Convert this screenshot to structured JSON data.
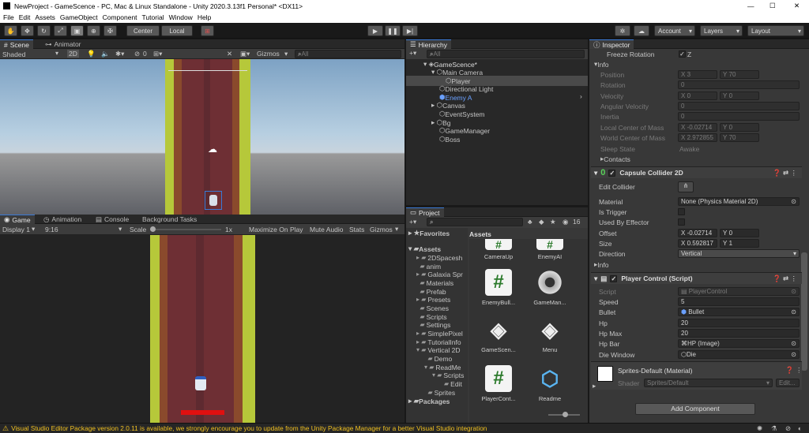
{
  "window": {
    "title": "NewProject - GameScence - PC, Mac & Linux Standalone - Unity 2020.3.13f1 Personal* <DX11>",
    "min": "—",
    "max": "☐",
    "close": "✕"
  },
  "menu": [
    "File",
    "Edit",
    "Assets",
    "GameObject",
    "Component",
    "Tutorial",
    "Window",
    "Help"
  ],
  "toolbar": {
    "center": "Center",
    "local": "Local",
    "account": "Account",
    "layers": "Layers",
    "layout": "Layout"
  },
  "scene": {
    "tabs": [
      "Scene",
      "Animator"
    ],
    "shading": "Shaded",
    "mode2d": "2D",
    "fx_count": "0",
    "gizmos": "Gizmos",
    "search_placeholder": "All"
  },
  "game": {
    "tabs": [
      "Game",
      "Animation",
      "Console",
      "Background Tasks"
    ],
    "display": "Display 1",
    "aspect": "9:16",
    "scale_label": "Scale",
    "scale_value": "1x",
    "maximize": "Maximize On Play",
    "mute": "Mute Audio",
    "stats": "Stats",
    "gizmos": "Gizmos"
  },
  "hierarchy": {
    "tab": "Hierarchy",
    "search_placeholder": "All",
    "scene": "GameScence*",
    "items": [
      "Main Camera",
      "Player",
      "Directional Light",
      "Enemy A",
      "Canvas",
      "EventSystem",
      "Bg",
      "GameManager",
      "Boss"
    ]
  },
  "project": {
    "tab": "Project",
    "favorites": "Favorites",
    "assets_root": "Assets",
    "breadcrumb": "Assets",
    "badge": "16",
    "tree": [
      "2DSpacesh",
      "anim",
      "Galaxia Spr",
      "Materials",
      "Prefab",
      "Presets",
      "Scenes",
      "Scripts",
      "Settings",
      "SimplePixel",
      "TutorialInfo",
      "Vertical 2D",
      "Demo",
      "ReadMe",
      "Scripts",
      "Edit",
      "Sprites"
    ],
    "packages": "Packages",
    "files": [
      "CameraUp",
      "EnemyAI",
      "EnemyBull...",
      "GameMan...",
      "GameScen...",
      "Menu",
      "PlayerCont...",
      "Readme"
    ]
  },
  "inspector": {
    "tab": "Inspector",
    "freeze_label": "Freeze Rotation",
    "freeze_z": "Z",
    "info": "Info",
    "rb": [
      {
        "label": "Position",
        "x": "3",
        "y": "70"
      },
      {
        "label": "Rotation",
        "v": "0"
      },
      {
        "label": "Velocity",
        "x": "0",
        "y": "0"
      },
      {
        "label": "Angular Velocity",
        "v": "0"
      },
      {
        "label": "Inertia",
        "v": "0"
      },
      {
        "label": "Local Center of Mass",
        "x": "-0.02714",
        "y": "0"
      },
      {
        "label": "World Center of Mass",
        "x": "2.972855",
        "y": "70"
      },
      {
        "label": "Sleep State",
        "v": "Awake"
      }
    ],
    "contacts": "Contacts",
    "capsule": {
      "title": "Capsule Collider 2D",
      "edit": "Edit Collider",
      "material_label": "Material",
      "material": "None (Physics Material 2D)",
      "trigger": "Is Trigger",
      "effector": "Used By Effector",
      "offset_label": "Offset",
      "offset_x": "-0.02714",
      "offset_y": "0",
      "size_label": "Size",
      "size_x": "0.592817",
      "size_y": "1",
      "direction_label": "Direction",
      "direction": "Vertical",
      "info": "Info"
    },
    "player": {
      "title": "Player Control (Script)",
      "script_label": "Script",
      "script": "PlayerControl",
      "speed_label": "Speed",
      "speed": "5",
      "bullet_label": "Bullet",
      "bullet": "Bullet",
      "hp_label": "Hp",
      "hp": "20",
      "hpmax_label": "Hp Max",
      "hpmax": "20",
      "hpbar_label": "Hp Bar",
      "hpbar": "HP (Image)",
      "die_label": "Die Window",
      "die": "Die"
    },
    "material": {
      "title": "Sprites-Default (Material)",
      "shader_label": "Shader",
      "shader": "Sprites/Default",
      "edit": "Edit..."
    },
    "add_component": "Add Component"
  },
  "status": "Visual Studio Editor Package version 2.0.11 is available, we strongly encourage you to update from the Unity Package Manager for a better Visual Studio integration",
  "colors": {
    "accent": "#3a7ad6",
    "road": "#6e2f34",
    "grass": "#b6c83a",
    "warning": "#f0c020",
    "hp_bar": "#e01010"
  }
}
